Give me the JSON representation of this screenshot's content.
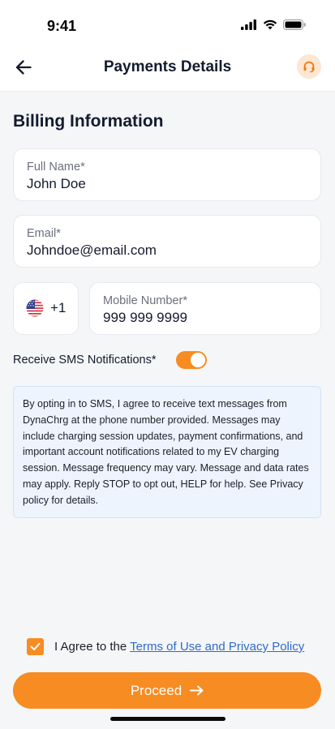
{
  "status_bar": {
    "time": "9:41"
  },
  "header": {
    "title": "Payments Details"
  },
  "billing": {
    "section_title": "Billing Information",
    "full_name": {
      "label": "Full Name*",
      "value": "John Doe"
    },
    "email": {
      "label": "Email*",
      "value": "Johndoe@email.com"
    },
    "country_code": "+1",
    "mobile": {
      "label": "Mobile Number*",
      "value": "999 999 9999"
    }
  },
  "sms": {
    "label": "Receive SMS Notifications*",
    "enabled": true,
    "disclaimer": "By opting in to SMS, I agree to receive text messages from DynaChrg at the phone number provided. Messages may include charging session updates, payment confirmations, and important account notifications related to my EV charging session. Message frequency may vary. Message and data rates may apply. Reply STOP to opt out, HELP for help. See Privacy policy for details."
  },
  "agreement": {
    "checked": true,
    "prefix": "I Agree to the ",
    "link_text": "Terms of Use and Privacy Policy"
  },
  "proceed_button": {
    "label": "Proceed"
  },
  "colors": {
    "accent": "#f78c22",
    "link": "#2f6cc6",
    "info_bg": "#eef4fd",
    "text_dark": "#131b2e"
  },
  "icons": {
    "back": "arrow-left-icon",
    "support": "headset-icon",
    "flag": "us-flag-icon",
    "checkbox": "checkmark-icon",
    "proceed": "arrow-right-icon"
  }
}
